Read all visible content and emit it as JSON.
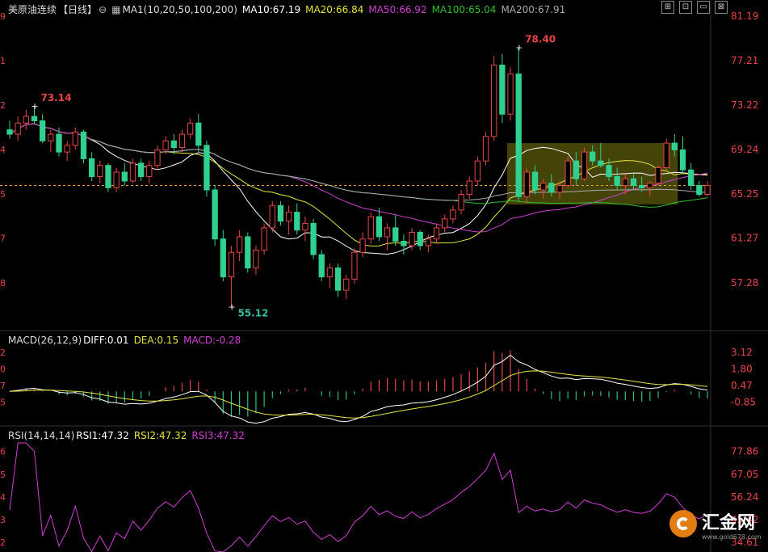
{
  "header": {
    "title": "美原油连续",
    "period": "【日线】",
    "ma_label": "MA1(10,20,50,100,200)",
    "ma10": "MA10:67.19",
    "ma20": "MA20:66.84",
    "ma50": "MA50:66.92",
    "ma100": "MA100:65.04",
    "ma200": "MA200:67.91",
    "colors": {
      "ma10": "#ffffff",
      "ma20": "#e6e640",
      "ma50": "#d040d0",
      "ma100": "#30c030",
      "ma200": "#aaaaaa"
    }
  },
  "macd_header": {
    "label": "MACD(26,12,9)",
    "diff": "DIFF:0.01",
    "dea": "DEA:0.15",
    "macd": "MACD:-0.28"
  },
  "rsi_header": {
    "label": "RSI(14,14,14)",
    "rsi1": "RSI1:47.32",
    "rsi2": "RSI2:47.32",
    "rsi3": "RSI3:47.32"
  },
  "logo": {
    "brand": "汇金网",
    "url": "www.gold678.com"
  },
  "window_icons": [
    "maximize-icon",
    "restore-icon",
    "minimize-icon",
    "close-icon"
  ],
  "window_icon_glyphs": [
    "⊞",
    "⊡",
    "▭",
    "⊠"
  ],
  "chart_data": [
    {
      "type": "candlestick",
      "title": "美原油连续【日线】",
      "y_axis_labels": [
        "81.19",
        "77.21",
        "73.22",
        "69.24",
        "65.25",
        "61.27",
        "57.28"
      ],
      "left_axis_labels": [
        "9",
        "1",
        "2",
        "4",
        "5",
        "7",
        "8"
      ],
      "ylim": [
        54.0,
        81.19
      ],
      "current_price": 66.0,
      "annotations": [
        {
          "text": "73.14",
          "value": 73.14,
          "index": 3,
          "color": "#e84545"
        },
        {
          "text": "78.40",
          "value": 78.4,
          "index": 62,
          "color": "#e84545"
        },
        {
          "text": "55.12",
          "value": 55.12,
          "index": 27,
          "color": "#30c0a0"
        }
      ],
      "consolidation_box": {
        "from_index": 61,
        "to_index": 81,
        "low": 64.3,
        "high": 69.8
      },
      "ohlc": [
        [
          71.0,
          71.8,
          70.2,
          70.6
        ],
        [
          70.6,
          72.2,
          70.0,
          71.6
        ],
        [
          71.6,
          72.8,
          71.0,
          72.2
        ],
        [
          72.2,
          73.14,
          71.5,
          71.8
        ],
        [
          71.8,
          72.4,
          69.8,
          70.0
        ],
        [
          70.0,
          71.0,
          69.0,
          70.6
        ],
        [
          70.6,
          71.2,
          68.6,
          69.0
        ],
        [
          69.0,
          70.0,
          68.2,
          69.6
        ],
        [
          69.6,
          71.2,
          69.2,
          70.8
        ],
        [
          70.8,
          71.0,
          68.0,
          68.4
        ],
        [
          68.4,
          69.0,
          66.4,
          66.8
        ],
        [
          66.8,
          68.2,
          66.2,
          67.8
        ],
        [
          67.8,
          68.0,
          65.4,
          65.8
        ],
        [
          65.8,
          67.6,
          65.4,
          67.2
        ],
        [
          67.2,
          68.0,
          66.0,
          66.4
        ],
        [
          66.4,
          68.4,
          66.2,
          68.0
        ],
        [
          68.0,
          68.4,
          66.4,
          66.8
        ],
        [
          66.8,
          68.2,
          66.2,
          67.8
        ],
        [
          67.8,
          69.6,
          67.4,
          69.2
        ],
        [
          69.2,
          70.4,
          68.8,
          70.0
        ],
        [
          70.0,
          70.6,
          68.8,
          69.4
        ],
        [
          69.4,
          71.0,
          69.0,
          70.6
        ],
        [
          70.6,
          72.0,
          70.2,
          71.6
        ],
        [
          71.6,
          72.4,
          69.0,
          69.6
        ],
        [
          69.6,
          70.0,
          65.0,
          65.6
        ],
        [
          65.6,
          66.0,
          60.6,
          61.2
        ],
        [
          61.2,
          62.0,
          57.4,
          57.8
        ],
        [
          57.8,
          60.6,
          55.12,
          60.0
        ],
        [
          60.0,
          62.0,
          59.2,
          61.4
        ],
        [
          61.4,
          61.8,
          58.2,
          58.6
        ],
        [
          58.6,
          60.6,
          58.0,
          60.2
        ],
        [
          60.2,
          62.6,
          59.8,
          62.2
        ],
        [
          62.2,
          64.6,
          61.8,
          64.2
        ],
        [
          64.2,
          64.6,
          62.4,
          62.8
        ],
        [
          62.8,
          64.2,
          61.6,
          63.6
        ],
        [
          63.6,
          64.4,
          61.6,
          62.0
        ],
        [
          62.0,
          63.2,
          61.0,
          62.6
        ],
        [
          62.6,
          63.0,
          59.4,
          59.8
        ],
        [
          59.8,
          60.2,
          57.4,
          57.8
        ],
        [
          57.8,
          59.0,
          56.8,
          58.6
        ],
        [
          58.6,
          59.0,
          56.0,
          56.6
        ],
        [
          56.6,
          58.0,
          55.8,
          57.6
        ],
        [
          57.6,
          60.4,
          57.2,
          60.0
        ],
        [
          60.0,
          61.8,
          59.6,
          61.2
        ],
        [
          61.2,
          63.6,
          60.8,
          63.2
        ],
        [
          63.2,
          64.0,
          61.0,
          61.4
        ],
        [
          61.4,
          62.6,
          60.2,
          62.2
        ],
        [
          62.2,
          63.4,
          60.6,
          61.0
        ],
        [
          61.0,
          61.6,
          59.8,
          60.6
        ],
        [
          60.6,
          62.2,
          60.2,
          61.8
        ],
        [
          61.8,
          62.0,
          60.2,
          60.6
        ],
        [
          60.6,
          61.6,
          60.0,
          61.2
        ],
        [
          61.2,
          62.6,
          60.8,
          62.2
        ],
        [
          62.2,
          63.4,
          61.8,
          63.0
        ],
        [
          63.0,
          64.2,
          62.6,
          63.8
        ],
        [
          63.8,
          65.6,
          63.4,
          65.2
        ],
        [
          65.2,
          66.8,
          64.8,
          66.4
        ],
        [
          66.4,
          68.6,
          66.0,
          68.2
        ],
        [
          68.2,
          70.8,
          67.8,
          70.4
        ],
        [
          70.4,
          77.6,
          70.0,
          76.8
        ],
        [
          76.8,
          77.8,
          71.6,
          72.4
        ],
        [
          72.4,
          76.6,
          71.8,
          76.0
        ],
        [
          76.0,
          78.4,
          64.6,
          65.0
        ],
        [
          65.0,
          67.6,
          64.4,
          67.2
        ],
        [
          67.2,
          67.8,
          65.2,
          65.6
        ],
        [
          65.6,
          66.6,
          64.8,
          66.2
        ],
        [
          66.2,
          67.0,
          65.0,
          65.4
        ],
        [
          65.4,
          66.4,
          64.8,
          66.0
        ],
        [
          66.0,
          68.6,
          65.8,
          68.2
        ],
        [
          68.2,
          69.0,
          66.0,
          66.6
        ],
        [
          66.6,
          69.4,
          66.4,
          69.0
        ],
        [
          69.0,
          69.6,
          67.8,
          68.2
        ],
        [
          68.2,
          69.8,
          67.6,
          67.8
        ],
        [
          67.8,
          68.4,
          66.4,
          66.8
        ],
        [
          66.8,
          67.6,
          65.6,
          66.0
        ],
        [
          66.0,
          67.0,
          65.2,
          66.6
        ],
        [
          66.6,
          67.0,
          65.6,
          66.0
        ],
        [
          66.0,
          66.8,
          65.4,
          65.8
        ],
        [
          65.8,
          66.4,
          65.0,
          66.2
        ],
        [
          66.2,
          67.8,
          66.0,
          67.6
        ],
        [
          67.6,
          70.2,
          67.4,
          69.8
        ],
        [
          69.8,
          70.6,
          68.6,
          69.2
        ],
        [
          69.2,
          70.4,
          67.0,
          67.4
        ],
        [
          67.4,
          68.0,
          65.6,
          66.0
        ],
        [
          66.0,
          66.4,
          65.0,
          65.2
        ],
        [
          65.2,
          66.4,
          65.0,
          66.0
        ]
      ]
    },
    {
      "type": "bar",
      "title": "MACD(26,12,9)",
      "y_axis_labels": [
        "3.12",
        "1.80",
        "0.47",
        "-0.85"
      ],
      "left_axis_labels": [
        "2",
        "0",
        "7",
        "5"
      ],
      "ylim": [
        -2.5,
        3.5
      ],
      "series": [
        {
          "name": "DIFF",
          "color": "#ffffff"
        },
        {
          "name": "DEA",
          "color": "#e6e640"
        },
        {
          "name": "MACD",
          "color_pos": "#e84545",
          "color_neg": "#30c080"
        }
      ]
    },
    {
      "type": "line",
      "title": "RSI(14,14,14)",
      "y_axis_labels": [
        "77.86",
        "67.05",
        "56.24",
        "45.42",
        "34.61"
      ],
      "left_axis_labels": [
        "6",
        "5",
        "4",
        "3",
        "2"
      ],
      "ylim": [
        30,
        82
      ],
      "series": [
        {
          "name": "RSI1",
          "color": "#d040d0"
        }
      ]
    }
  ]
}
